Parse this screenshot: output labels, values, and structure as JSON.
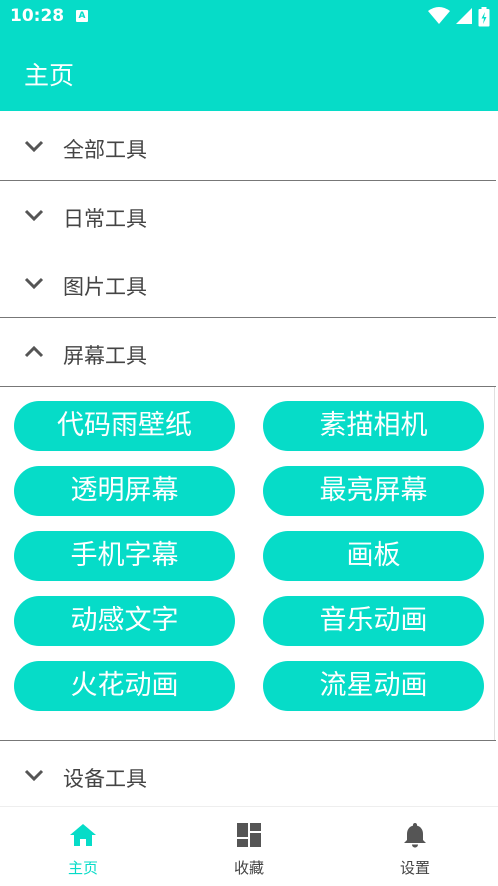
{
  "status_bar": {
    "time": "10:28",
    "badge": "A"
  },
  "app_bar": {
    "title": "主页"
  },
  "sections": [
    {
      "label": "全部工具",
      "expanded": false
    },
    {
      "label": "日常工具",
      "expanded": false
    },
    {
      "label": "图片工具",
      "expanded": false
    },
    {
      "label": "屏幕工具",
      "expanded": true
    },
    {
      "label": "设备工具",
      "expanded": false
    }
  ],
  "screen_tools": [
    "代码雨壁纸",
    "素描相机",
    "透明屏幕",
    "最亮屏幕",
    "手机字幕",
    "画板",
    "动感文字",
    "音乐动画",
    "火花动画",
    "流星动画"
  ],
  "bottom_nav": [
    {
      "label": "主页",
      "icon": "home-icon",
      "active": true
    },
    {
      "label": "收藏",
      "icon": "dashboard-icon",
      "active": false
    },
    {
      "label": "设置",
      "icon": "bell-icon",
      "active": false
    }
  ],
  "colors": {
    "accent": "#06dcc8",
    "text": "#444444",
    "icon_gray": "#555555"
  }
}
